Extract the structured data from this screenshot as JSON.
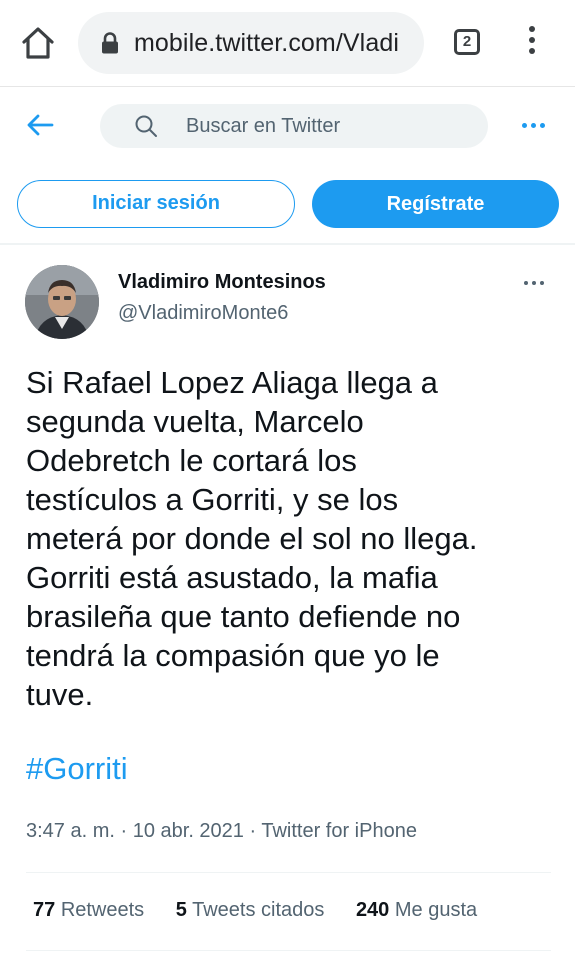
{
  "browser": {
    "url": "mobile.twitter.com/Vladi",
    "tab_count": "2"
  },
  "header": {
    "search_placeholder": "Buscar en Twitter"
  },
  "auth": {
    "login_label": "Iniciar sesión",
    "signup_label": "Regístrate"
  },
  "tweet": {
    "display_name": "Vladimiro Montesinos",
    "handle": "@VladimiroMonte6",
    "text": "Si Rafael Lopez Aliaga llega a\nsegunda vuelta, Marcelo\nOdebretch le cortará los\ntestículos a Gorriti, y se los\nmeterá por donde el sol no llega.\nGorriti está asustado, la mafia\nbrasileña que tanto defiende no\ntendrá la compasión que yo le\ntuve.",
    "hashtag": "#Gorriti",
    "meta": "3:47 a. m. · 10 abr. 2021 · Twitter for iPhone",
    "stats": {
      "retweets_count": "77",
      "retweets_label": "Retweets",
      "quotes_count": "5",
      "quotes_label": "Tweets citados",
      "likes_count": "240",
      "likes_label": "Me gusta"
    }
  },
  "colors": {
    "accent": "#1d9bf0",
    "text": "#0f1419",
    "secondary": "#536471"
  }
}
